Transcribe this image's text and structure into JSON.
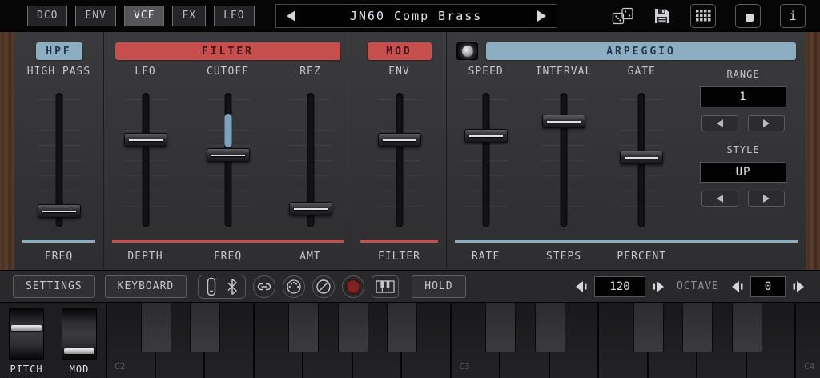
{
  "colors": {
    "accent_red": "#c64f4d",
    "accent_blue": "#8cadc2",
    "record_red": "#7e2222",
    "wood": "#553a2a"
  },
  "top_bar": {
    "tabs": [
      {
        "label": "DCO",
        "active": false
      },
      {
        "label": "ENV",
        "active": false
      },
      {
        "label": "VCF",
        "active": true
      },
      {
        "label": "FX",
        "active": false
      },
      {
        "label": "LFO",
        "active": false
      }
    ],
    "preset": {
      "name": "JN60 Comp Brass"
    },
    "icons": {
      "dice": "dice",
      "save": "save-floppy",
      "grid": "pattern-grid",
      "pad": "pad-window",
      "info_glyph": "i"
    }
  },
  "hpf": {
    "header": "HPF",
    "top_label": "HIGH PASS",
    "bottom_label": "FREQ",
    "slider_pct": 92
  },
  "filter": {
    "header": "FILTER",
    "sliders": [
      {
        "top": "LFO",
        "bottom": "DEPTH",
        "pct": 33
      },
      {
        "top": "CUTOFF",
        "bottom": "FREQ",
        "pct": 46
      },
      {
        "top": "REZ",
        "bottom": "AMT",
        "pct": 90
      }
    ]
  },
  "mod": {
    "header": "MOD",
    "sliders": [
      {
        "top": "ENV",
        "bottom": "FILTER",
        "pct": 33
      }
    ]
  },
  "arpeggio": {
    "header": "ARPEGGIO",
    "enabled": true,
    "sliders": [
      {
        "top": "SPEED",
        "bottom": "RATE",
        "pct": 30
      },
      {
        "top": "INTERVAL",
        "bottom": "STEPS",
        "pct": 18
      },
      {
        "top": "GATE",
        "bottom": "PERCENT",
        "pct": 48
      }
    ],
    "range_label": "RANGE",
    "range_value": "1",
    "style_label": "STYLE",
    "style_value": "UP"
  },
  "toolbar": {
    "settings": "SETTINGS",
    "keyboard": "KEYBOARD",
    "hold": "HOLD",
    "tempo": "120",
    "octave_label": "OCTAVE",
    "octave": "0",
    "icon_buttons": [
      "device",
      "bluetooth",
      "link",
      "midi",
      "panic",
      "record",
      "piano"
    ]
  },
  "wheels": {
    "pitch_label": "PITCH",
    "mod_label": "MOD",
    "pitch_pct": 36,
    "mod_pct": 88
  },
  "keyboard": {
    "white_count": 15,
    "labels": {
      "0": "C2",
      "7": "C3",
      "14": "C4"
    },
    "black_after": [
      0,
      1,
      3,
      4,
      5,
      7,
      8,
      10,
      11,
      12
    ]
  }
}
